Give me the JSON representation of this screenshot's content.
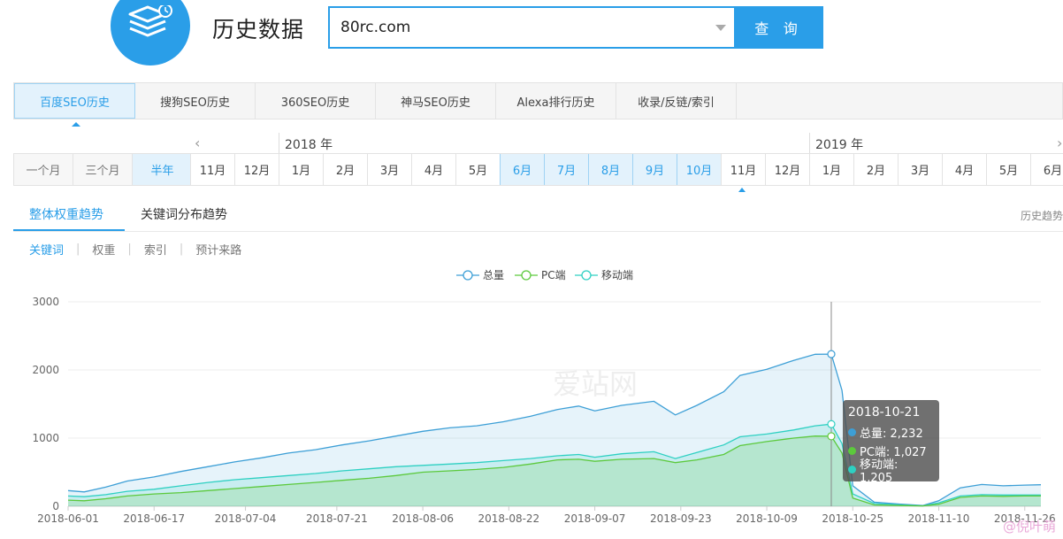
{
  "header": {
    "title": "历史数据",
    "search_value": "80rc.com",
    "search_button": "查 询"
  },
  "main_tabs": [
    {
      "label": "百度SEO历史",
      "active": true
    },
    {
      "label": "搜狗SEO历史",
      "active": false
    },
    {
      "label": "360SEO历史",
      "active": false
    },
    {
      "label": "神马SEO历史",
      "active": false
    },
    {
      "label": "Alexa排行历史",
      "active": false
    },
    {
      "label": "收录/反链/索引",
      "active": false
    }
  ],
  "range_buttons": [
    {
      "label": "一个月",
      "active": false
    },
    {
      "label": "三个月",
      "active": false
    },
    {
      "label": "半年",
      "active": true
    }
  ],
  "timeline": {
    "year_2018": "2018 年",
    "year_2019": "2019 年",
    "months": [
      "11月",
      "12月",
      "1月",
      "2月",
      "3月",
      "4月",
      "5月",
      "6月",
      "7月",
      "8月",
      "9月",
      "10月",
      "11月",
      "12月",
      "1月",
      "2月",
      "3月",
      "4月",
      "5月",
      "6月"
    ],
    "selected": [
      7,
      8,
      9,
      10,
      11
    ]
  },
  "sub_tabs": {
    "overall": "整体权重趋势",
    "keywords": "关键词分布趋势",
    "history_link": "历史趋势"
  },
  "filters": [
    "关键词",
    "权重",
    "索引",
    "预计来路"
  ],
  "watermark": "爱站网",
  "corner_mark": "@倪叶萌",
  "tooltip": {
    "date": "2018-10-21",
    "rows": [
      "总量: 2,232",
      "PC端: 1,027",
      "移动端: 1,205"
    ]
  },
  "colors": {
    "accent": "#2a9ee8",
    "total": "#3d9fd6",
    "pc": "#5cc93c",
    "mobile": "#2ed0c2"
  },
  "chart_data": {
    "type": "area",
    "legend": [
      "总量",
      "PC端",
      "移动端"
    ],
    "legend_position": "top-center",
    "ylim": [
      0,
      3000
    ],
    "yticks": [
      0,
      1000,
      2000,
      3000
    ],
    "grid": true,
    "x_tick_labels": [
      "2018-06-01",
      "2018-06-17",
      "2018-07-04",
      "2018-07-21",
      "2018-08-06",
      "2018-08-22",
      "2018-09-07",
      "2018-09-23",
      "2018-10-09",
      "2018-10-25",
      "2018-11-10",
      "2018-11-26"
    ],
    "series": [
      {
        "name": "总量",
        "points": [
          [
            "2018-06-01",
            230
          ],
          [
            "2018-06-04",
            210
          ],
          [
            "2018-06-08",
            280
          ],
          [
            "2018-06-12",
            370
          ],
          [
            "2018-06-17",
            430
          ],
          [
            "2018-06-22",
            510
          ],
          [
            "2018-06-27",
            580
          ],
          [
            "2018-07-02",
            650
          ],
          [
            "2018-07-07",
            710
          ],
          [
            "2018-07-12",
            780
          ],
          [
            "2018-07-17",
            830
          ],
          [
            "2018-07-22",
            900
          ],
          [
            "2018-07-27",
            960
          ],
          [
            "2018-08-01",
            1030
          ],
          [
            "2018-08-06",
            1100
          ],
          [
            "2018-08-11",
            1150
          ],
          [
            "2018-08-16",
            1180
          ],
          [
            "2018-08-21",
            1240
          ],
          [
            "2018-08-26",
            1320
          ],
          [
            "2018-08-31",
            1420
          ],
          [
            "2018-09-04",
            1470
          ],
          [
            "2018-09-07",
            1400
          ],
          [
            "2018-09-12",
            1480
          ],
          [
            "2018-09-18",
            1540
          ],
          [
            "2018-09-22",
            1340
          ],
          [
            "2018-09-26",
            1480
          ],
          [
            "2018-10-01",
            1680
          ],
          [
            "2018-10-04",
            1920
          ],
          [
            "2018-10-09",
            2010
          ],
          [
            "2018-10-14",
            2140
          ],
          [
            "2018-10-18",
            2230
          ],
          [
            "2018-10-21",
            2232
          ],
          [
            "2018-10-23",
            1700
          ],
          [
            "2018-10-25",
            300
          ],
          [
            "2018-10-29",
            60
          ],
          [
            "2018-11-03",
            30
          ],
          [
            "2018-11-07",
            10
          ],
          [
            "2018-11-10",
            80
          ],
          [
            "2018-11-14",
            270
          ],
          [
            "2018-11-18",
            320
          ],
          [
            "2018-11-22",
            300
          ],
          [
            "2018-11-26",
            310
          ],
          [
            "2018-11-29",
            315
          ]
        ]
      },
      {
        "name": "PC端",
        "points": [
          [
            "2018-06-01",
            90
          ],
          [
            "2018-06-04",
            80
          ],
          [
            "2018-06-08",
            110
          ],
          [
            "2018-06-12",
            150
          ],
          [
            "2018-06-17",
            180
          ],
          [
            "2018-06-22",
            200
          ],
          [
            "2018-06-27",
            230
          ],
          [
            "2018-07-02",
            260
          ],
          [
            "2018-07-07",
            290
          ],
          [
            "2018-07-12",
            320
          ],
          [
            "2018-07-17",
            350
          ],
          [
            "2018-07-22",
            380
          ],
          [
            "2018-07-27",
            410
          ],
          [
            "2018-08-01",
            450
          ],
          [
            "2018-08-06",
            500
          ],
          [
            "2018-08-11",
            520
          ],
          [
            "2018-08-16",
            540
          ],
          [
            "2018-08-21",
            570
          ],
          [
            "2018-08-26",
            620
          ],
          [
            "2018-08-31",
            680
          ],
          [
            "2018-09-04",
            690
          ],
          [
            "2018-09-07",
            660
          ],
          [
            "2018-09-12",
            690
          ],
          [
            "2018-09-18",
            700
          ],
          [
            "2018-09-22",
            640
          ],
          [
            "2018-09-26",
            680
          ],
          [
            "2018-10-01",
            760
          ],
          [
            "2018-10-04",
            890
          ],
          [
            "2018-10-09",
            950
          ],
          [
            "2018-10-14",
            1000
          ],
          [
            "2018-10-18",
            1030
          ],
          [
            "2018-10-21",
            1027
          ],
          [
            "2018-10-23",
            780
          ],
          [
            "2018-10-25",
            120
          ],
          [
            "2018-10-29",
            20
          ],
          [
            "2018-11-03",
            10
          ],
          [
            "2018-11-07",
            5
          ],
          [
            "2018-11-10",
            30
          ],
          [
            "2018-11-14",
            130
          ],
          [
            "2018-11-18",
            150
          ],
          [
            "2018-11-22",
            145
          ],
          [
            "2018-11-26",
            150
          ],
          [
            "2018-11-29",
            150
          ]
        ]
      },
      {
        "name": "移动端",
        "points": [
          [
            "2018-06-01",
            150
          ],
          [
            "2018-06-04",
            140
          ],
          [
            "2018-06-08",
            170
          ],
          [
            "2018-06-12",
            220
          ],
          [
            "2018-06-17",
            250
          ],
          [
            "2018-06-22",
            300
          ],
          [
            "2018-06-27",
            350
          ],
          [
            "2018-07-02",
            390
          ],
          [
            "2018-07-07",
            420
          ],
          [
            "2018-07-12",
            450
          ],
          [
            "2018-07-17",
            480
          ],
          [
            "2018-07-22",
            520
          ],
          [
            "2018-07-27",
            550
          ],
          [
            "2018-08-01",
            580
          ],
          [
            "2018-08-06",
            600
          ],
          [
            "2018-08-11",
            620
          ],
          [
            "2018-08-16",
            640
          ],
          [
            "2018-08-21",
            670
          ],
          [
            "2018-08-26",
            700
          ],
          [
            "2018-08-31",
            740
          ],
          [
            "2018-09-04",
            760
          ],
          [
            "2018-09-07",
            720
          ],
          [
            "2018-09-12",
            770
          ],
          [
            "2018-09-18",
            800
          ],
          [
            "2018-09-22",
            700
          ],
          [
            "2018-09-26",
            790
          ],
          [
            "2018-10-01",
            900
          ],
          [
            "2018-10-04",
            1020
          ],
          [
            "2018-10-09",
            1060
          ],
          [
            "2018-10-14",
            1120
          ],
          [
            "2018-10-18",
            1180
          ],
          [
            "2018-10-21",
            1205
          ],
          [
            "2018-10-23",
            920
          ],
          [
            "2018-10-25",
            180
          ],
          [
            "2018-10-29",
            40
          ],
          [
            "2018-11-03",
            20
          ],
          [
            "2018-11-07",
            5
          ],
          [
            "2018-11-10",
            50
          ],
          [
            "2018-11-14",
            150
          ],
          [
            "2018-11-18",
            170
          ],
          [
            "2018-11-22",
            165
          ],
          [
            "2018-11-26",
            165
          ],
          [
            "2018-11-29",
            165
          ]
        ]
      }
    ],
    "highlight_x": "2018-10-21"
  }
}
